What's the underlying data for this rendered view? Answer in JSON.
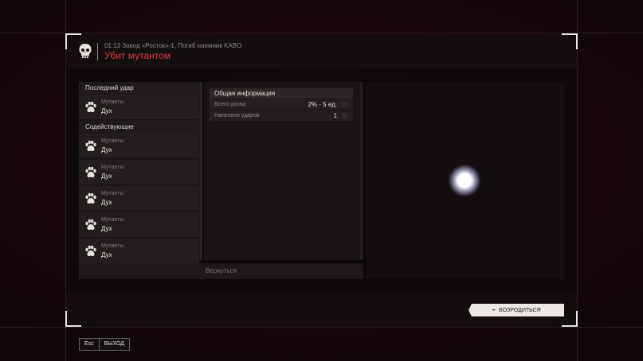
{
  "header": {
    "subtitle": "01:13 Завод «Росток»-1, Погиб наемник KABO",
    "title": "Убит мутантом",
    "title_color": "#e0393e",
    "icon": "skull-icon"
  },
  "last_hit": {
    "section_label": "Последний удар",
    "row": {
      "category": "Мутанты",
      "name": "Дух",
      "icon": "paw-icon"
    }
  },
  "assists": {
    "section_label": "Содействующие",
    "rows": [
      {
        "category": "Мутанты",
        "name": "Дух",
        "icon": "paw-icon"
      },
      {
        "category": "Мутанты",
        "name": "Дух",
        "icon": "paw-icon"
      },
      {
        "category": "Мутанты",
        "name": "Дух",
        "icon": "paw-icon"
      },
      {
        "category": "Мутанты",
        "name": "Дух",
        "icon": "paw-icon"
      },
      {
        "category": "Мутанты",
        "name": "Дух",
        "icon": "paw-icon"
      }
    ]
  },
  "info": {
    "title": "Общая информация",
    "rows": [
      {
        "label": "Всего урона",
        "value": "2% - 5 ед."
      },
      {
        "label": "Нанесено ударов",
        "value": "1"
      }
    ]
  },
  "back_label": "Вернуться",
  "respawn_label": "ВОЗРОДИТЬСЯ",
  "footer": {
    "key": "Esc",
    "action": "ВЫХОД"
  }
}
